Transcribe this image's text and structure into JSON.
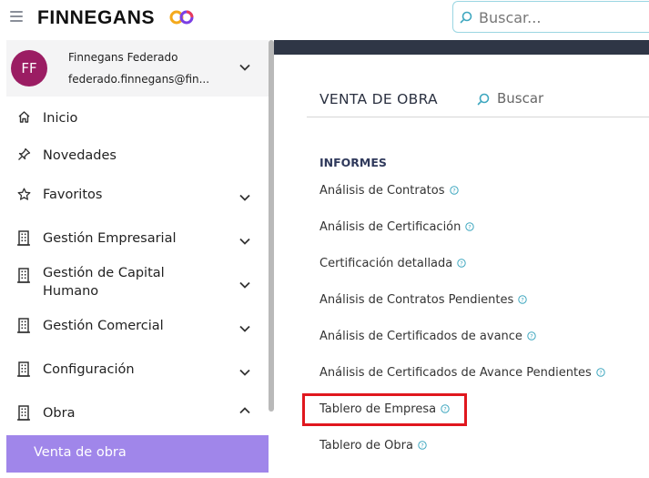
{
  "topbar": {
    "logo_text": "FINNEGANS",
    "search_placeholder": "Buscar..."
  },
  "user": {
    "initials": "FF",
    "name": "Finnegans Federado",
    "email": "federado.finnegans@fin..."
  },
  "sidebar": {
    "items": [
      {
        "label": "Inicio",
        "icon": "home-icon"
      },
      {
        "label": "Novedades",
        "icon": "pin-icon"
      },
      {
        "label": "Favoritos",
        "icon": "star-icon"
      },
      {
        "label": "Gestión Empresarial",
        "icon": "building-icon"
      },
      {
        "label": "Gestión de Capital Humano",
        "icon": "building-icon"
      },
      {
        "label": "Gestión Comercial",
        "icon": "building-icon"
      },
      {
        "label": "Configuración",
        "icon": "building-icon"
      },
      {
        "label": "Obra",
        "icon": "building-icon"
      }
    ],
    "active_subitem": "Venta de obra"
  },
  "main": {
    "title": "VENTA DE OBRA",
    "search_placeholder": "Buscar",
    "section_title": "INFORMES",
    "reports": [
      "Análisis de Contratos",
      "Análisis de Certificación",
      "Certificación detallada",
      "Análisis de Contratos Pendientes",
      "Análisis de Certificados de avance",
      "Análisis de Certificados de Avance Pendientes",
      "Tablero de Empresa",
      "Tablero de Obra"
    ]
  },
  "colors": {
    "accent": "#a086ea",
    "avatar": "#9b1d63",
    "header_bar": "#2f3646",
    "highlight": "#e0171e",
    "search_border": "#9ad6e2"
  }
}
